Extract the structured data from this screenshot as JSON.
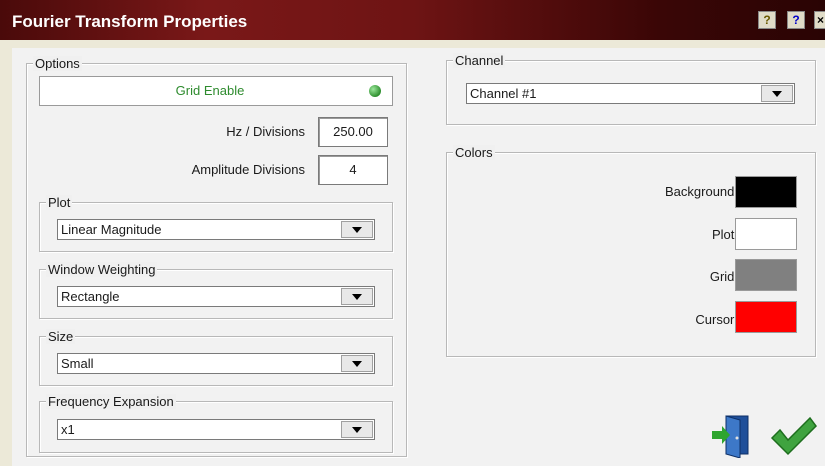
{
  "window": {
    "title": "Fourier Transform Properties",
    "hint_label": "?",
    "help_label": "?",
    "close_label": "×"
  },
  "options": {
    "legend": "Options",
    "grid_enable_label": "Grid Enable",
    "hz_div_label": "Hz / Divisions",
    "hz_div_value": "250.00",
    "amp_div_label": "Amplitude Divisions",
    "amp_div_value": "4"
  },
  "plot": {
    "legend": "Plot",
    "value": "Linear Magnitude"
  },
  "window_weighting": {
    "legend": "Window Weighting",
    "value": "Rectangle"
  },
  "size": {
    "legend": "Size",
    "value": "Small"
  },
  "freq_expansion": {
    "legend": "Frequency Expansion",
    "value": "x1"
  },
  "channel": {
    "legend": "Channel",
    "value": "Channel #1"
  },
  "colors": {
    "legend": "Colors",
    "items": [
      {
        "label": "Background:",
        "color": "#000000"
      },
      {
        "label": "Plot:",
        "color": "#ffffff"
      },
      {
        "label": "Grid:",
        "color": "#808080"
      },
      {
        "label": "Cursor:",
        "color": "#ff0000"
      }
    ]
  },
  "actions": {
    "exit_icon": "exit-door-icon",
    "ok_icon": "checkmark-icon"
  }
}
